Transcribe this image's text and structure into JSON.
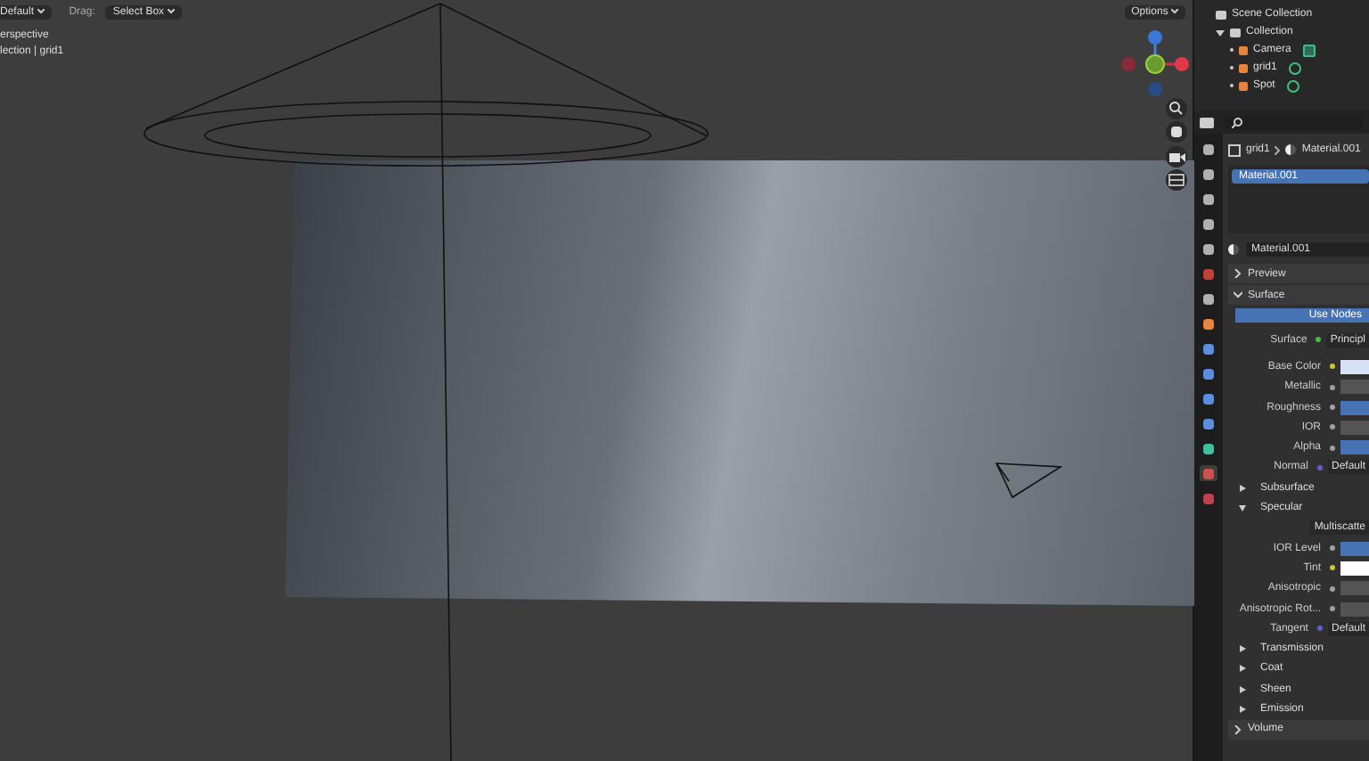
{
  "header": {
    "mode": "Default",
    "drag_label": "Drag:",
    "drag_value": "Select Box",
    "options": "Options"
  },
  "viewport": {
    "view_name": "erspective",
    "collection_path": "lection | grid1"
  },
  "outliner": {
    "title": "Scene Collection",
    "items": [
      {
        "label": "Collection",
        "expanded": true,
        "children": [
          {
            "label": "Camera",
            "kind": "camera",
            "color": "#e8843c"
          },
          {
            "label": "grid1",
            "kind": "mesh",
            "color": "#e8843c"
          },
          {
            "label": "Spot",
            "kind": "light",
            "color": "#e8843c"
          }
        ]
      }
    ]
  },
  "properties": {
    "tabs": [
      {
        "selected": false,
        "color": "#b0b0b0"
      },
      {
        "selected": false,
        "color": "#b0b0b0"
      },
      {
        "selected": false,
        "color": "#b0b0b0"
      },
      {
        "selected": false,
        "color": "#b0b0b0"
      },
      {
        "selected": false,
        "color": "#b0b0b0"
      },
      {
        "selected": false,
        "color": "#c0403a"
      },
      {
        "selected": false,
        "color": "#b0b0b0"
      },
      {
        "selected": false,
        "color": "#e8843c"
      },
      {
        "selected": false,
        "color": "#5b8ee0"
      },
      {
        "selected": false,
        "color": "#5b8ee0"
      },
      {
        "selected": false,
        "color": "#5b8ee0"
      },
      {
        "selected": false,
        "color": "#5b8ee0"
      },
      {
        "selected": false,
        "color": "#3cc0a0"
      },
      {
        "selected": true,
        "color": "#d05050"
      },
      {
        "selected": false,
        "color": "#c04050"
      }
    ],
    "breadcrumb": [
      "grid1",
      "Material.001"
    ],
    "slots": [
      {
        "label": "Material.001",
        "selected": true
      }
    ],
    "material": "Material.001",
    "rows": [
      {
        "kind": "section",
        "label": "Preview",
        "expanded": false
      },
      {
        "kind": "section",
        "label": "Surface",
        "expanded": true
      },
      {
        "kind": "button",
        "label": "Use Nodes"
      },
      {
        "kind": "dropdown",
        "label": "Surface",
        "socket": {
          "color": "#40c040"
        },
        "value": "Principl"
      },
      {
        "kind": "gap"
      },
      {
        "kind": "swatch",
        "label": "Base Color",
        "socket": {
          "color": "#c8c832"
        },
        "color": "#d6e2f4"
      },
      {
        "kind": "number",
        "label": "Metallic",
        "socket": {
          "color": "#a0a0a0"
        }
      },
      {
        "kind": "slider",
        "label": "Roughness",
        "socket": {
          "color": "#a0a0a0"
        },
        "level": 1
      },
      {
        "kind": "number",
        "label": "IOR",
        "socket": {
          "color": "#a0a0a0"
        }
      },
      {
        "kind": "slider",
        "label": "Alpha",
        "socket": {
          "color": "#a0a0a0"
        },
        "level": 1
      },
      {
        "kind": "dropdown",
        "label": "Normal",
        "socket": {
          "color": "#6060d0"
        },
        "value": "Default"
      },
      {
        "kind": "subsection",
        "label": "Subsurface",
        "expanded": false
      },
      {
        "kind": "subsection",
        "label": "Specular",
        "expanded": true
      },
      {
        "kind": "dropdown",
        "value": "Multiscatte"
      },
      {
        "kind": "slider",
        "label": "IOR Level",
        "socket": {
          "color": "#a0a0a0"
        },
        "level": 1
      },
      {
        "kind": "swatch",
        "label": "Tint",
        "socket": {
          "color": "#c8c832"
        },
        "color": "#ffffff"
      },
      {
        "kind": "number",
        "label": "Anisotropic",
        "socket": {
          "color": "#a0a0a0"
        }
      },
      {
        "kind": "number",
        "label": "Anisotropic Rot...",
        "socket": {
          "color": "#a0a0a0"
        }
      },
      {
        "kind": "dropdown",
        "label": "Tangent",
        "socket": {
          "color": "#6060d0"
        },
        "value": "Default"
      },
      {
        "kind": "subsection",
        "label": "Transmission",
        "expanded": false
      },
      {
        "kind": "subsection",
        "label": "Coat",
        "expanded": false
      },
      {
        "kind": "subsection",
        "label": "Sheen",
        "expanded": false
      },
      {
        "kind": "subsection",
        "label": "Emission",
        "expanded": false
      },
      {
        "kind": "section",
        "label": "Volume",
        "expanded": false
      }
    ]
  }
}
